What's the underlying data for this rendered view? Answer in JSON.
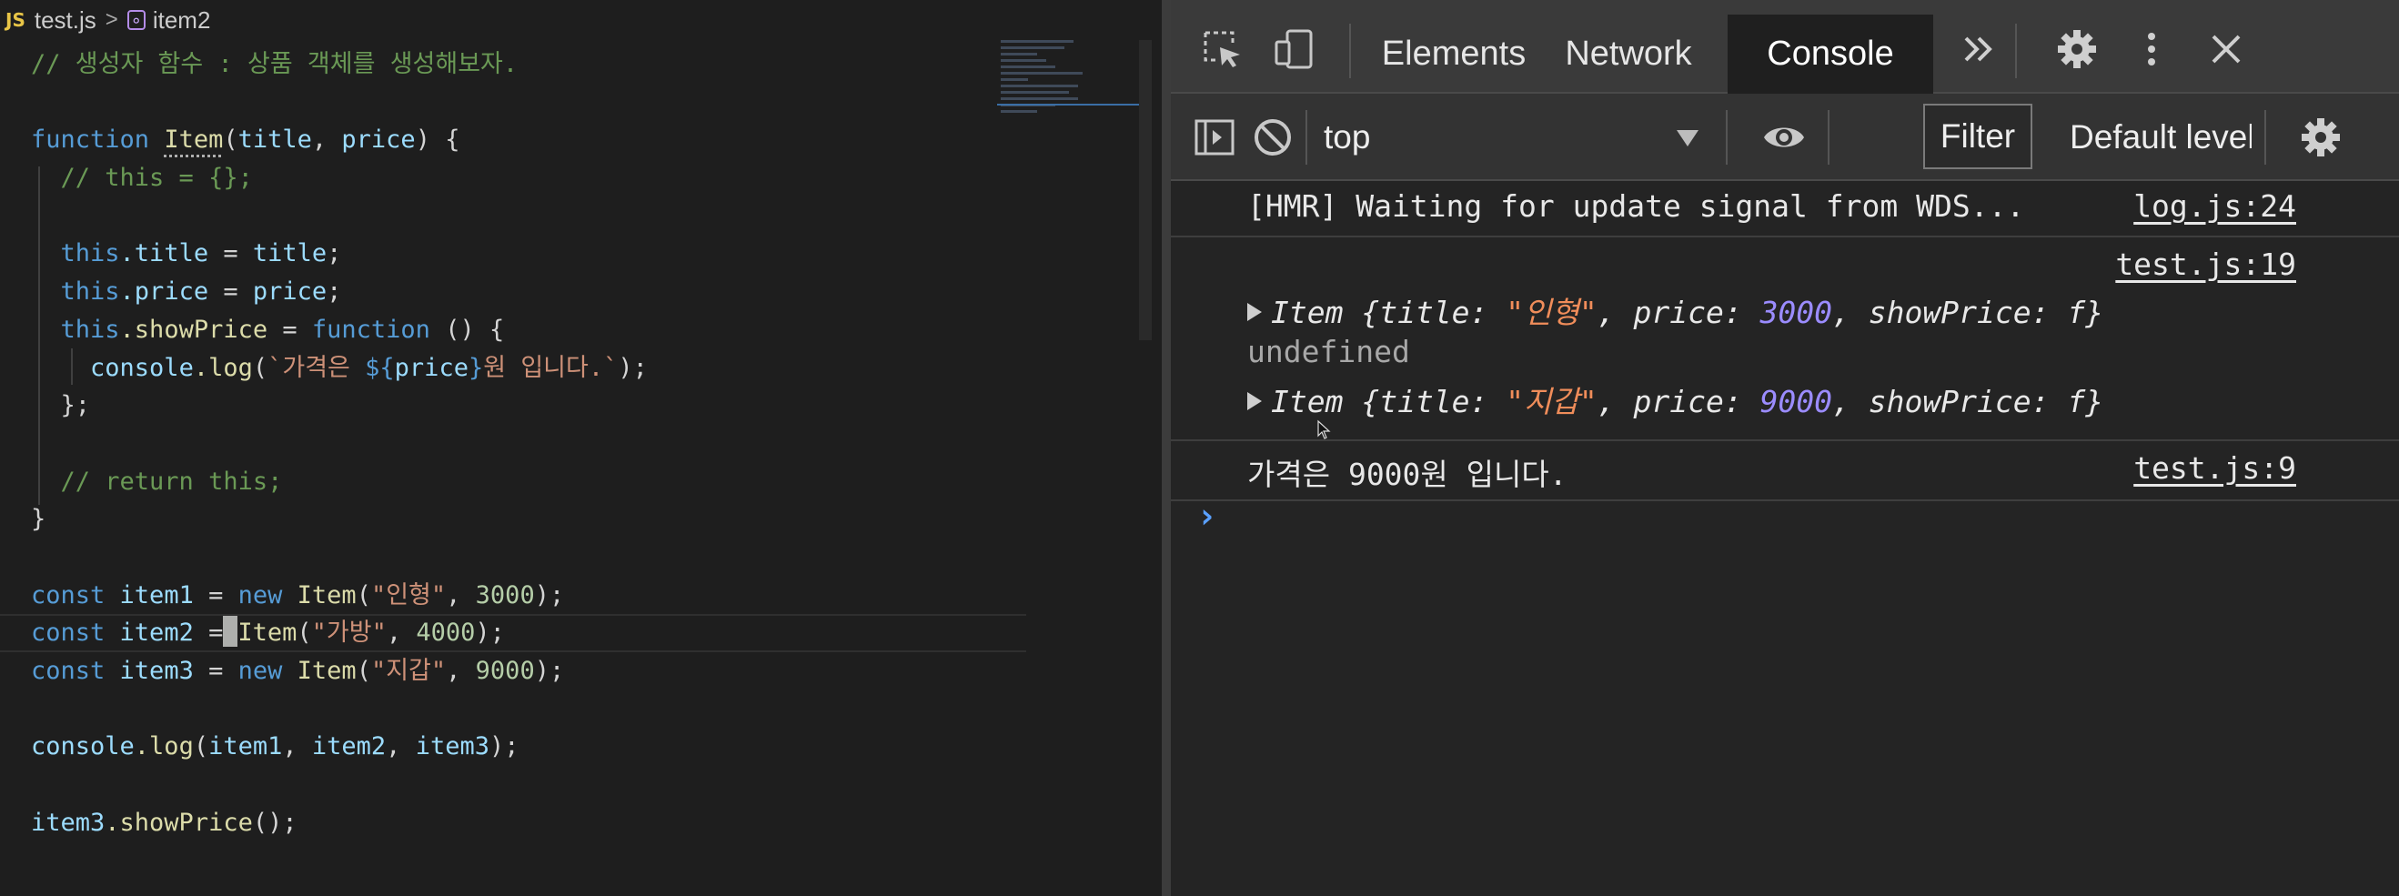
{
  "editor": {
    "breadcrumb": {
      "lang_badge": "JS",
      "file": "test.js",
      "separator": ">",
      "symbol_icon": "symbol-variable-icon",
      "symbol": "item2"
    },
    "lines": {
      "l1": "// 생성자 함수 : 상품 객체를 생성해보자.",
      "l3_kw": "function",
      "l3_name": "Item",
      "l3_params_open": "(",
      "l3_p1": "title",
      "l3_comma": ", ",
      "l3_p2": "price",
      "l3_close": ") {",
      "l4": "// this = {};",
      "l6_this": "this",
      "l6_prop": ".title",
      "l6_eq": " = ",
      "l6_val": "title",
      "l6_end": ";",
      "l7_this": "this",
      "l7_prop": ".price",
      "l7_eq": " = ",
      "l7_val": "price",
      "l7_end": ";",
      "l8_this": "this",
      "l8_prop": ".showPrice",
      "l8_eq": " = ",
      "l8_kw": "function",
      "l8_end": " () {",
      "l9_obj": "console",
      "l9_fn": ".log",
      "l9_open": "(",
      "l9_str1": "`가격은 ",
      "l9_tpl_open": "${",
      "l9_var": "price",
      "l9_tpl_close": "}",
      "l9_str2": "원 입니다.`",
      "l9_close": ");",
      "l10": "};",
      "l12": "// return this;",
      "l13": "}",
      "l15_kw": "const",
      "l15_var": "item1",
      "l15_eq": " = ",
      "l15_new": "new",
      "l15_cls": "Item",
      "l15_open": "(",
      "l15_str": "\"인형\"",
      "l15_comma": ", ",
      "l15_num": "3000",
      "l15_close": ");",
      "l16_kw": "const",
      "l16_var": "item2",
      "l16_eq": " =",
      "l16_cls": "Item",
      "l16_open": "(",
      "l16_str": "\"가방\"",
      "l16_comma": ", ",
      "l16_num": "4000",
      "l16_close": ");",
      "l17_kw": "const",
      "l17_var": "item3",
      "l17_eq": " = ",
      "l17_new": "new",
      "l17_cls": "Item",
      "l17_open": "(",
      "l17_str": "\"지갑\"",
      "l17_comma": ", ",
      "l17_num": "9000",
      "l17_close": ");",
      "l19_obj": "console",
      "l19_fn": ".log",
      "l19_open": "(",
      "l19_a1": "item1",
      "l19_c1": ", ",
      "l19_a2": "item2",
      "l19_c2": ", ",
      "l19_a3": "item3",
      "l19_close": ");",
      "l21_obj": "item3",
      "l21_fn": ".showPrice",
      "l21_close": "();"
    }
  },
  "devtools": {
    "tabs": [
      "Elements",
      "Network",
      "Console"
    ],
    "active_tab": "Console",
    "more_tabs_icon": "chevron-double-right-icon",
    "toolbar": {
      "context": "top",
      "filter_label": "Filter",
      "levels_label": "Default levels"
    },
    "console": {
      "hmr_message": "[HMR] Waiting for update signal from WDS...",
      "hmr_source": "log.js:24",
      "log1_source": "test.js:19",
      "obj1": {
        "prefix": "Item {title: ",
        "title": "\"인형\"",
        "mid": ", price: ",
        "price": "3000",
        "suffix": ", showPrice: f}"
      },
      "undefined_text": "undefined",
      "obj2": {
        "prefix": "Item {title: ",
        "title": "\"지갑\"",
        "mid": ", price: ",
        "price": "9000",
        "suffix": ", showPrice: f}"
      },
      "price_message": "가격은 9000원 입니다.",
      "price_source": "test.js:9",
      "prompt": "›"
    }
  },
  "colors": {
    "editor_bg": "#1e1e1e",
    "keyword": "#569cd6",
    "comment": "#6a9955",
    "string": "#ce9178",
    "function": "#dcdcaa",
    "variable": "#9cdcfe",
    "number": "#b5cea8",
    "console_string": "#f08d5a",
    "console_number": "#9b8cff",
    "prompt": "#5aa0ff"
  }
}
